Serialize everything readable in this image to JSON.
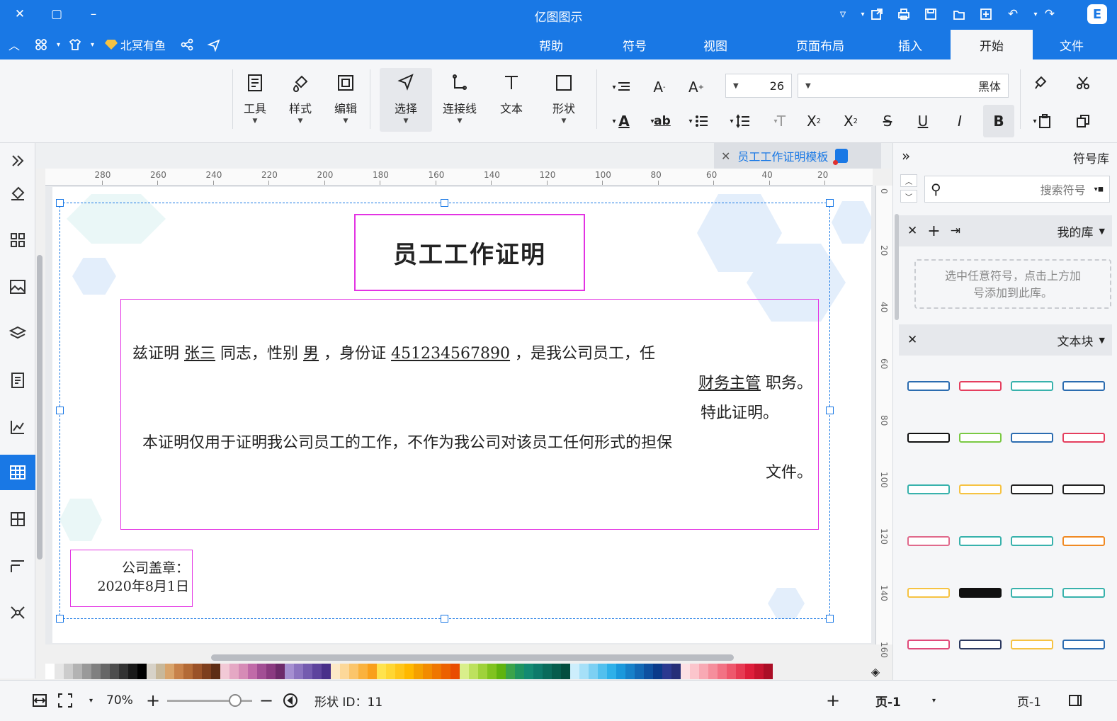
{
  "app": {
    "title": "亿图图示"
  },
  "tabs": [
    "文件",
    "开始",
    "插入",
    "页面布局",
    "视图",
    "符号",
    "帮助"
  ],
  "active_tab": "开始",
  "brand": {
    "label": "北冥有鱼"
  },
  "ribbon": {
    "tools": [
      {
        "icon": "tool-icon",
        "label": "工具"
      },
      {
        "icon": "style-icon",
        "label": "样式"
      },
      {
        "icon": "edit-icon",
        "label": "编辑"
      },
      {
        "icon": "select-icon",
        "label": "选择"
      },
      {
        "icon": "connector-icon",
        "label": "连接线"
      },
      {
        "icon": "text-icon",
        "label": "文本"
      },
      {
        "icon": "shape-icon",
        "label": "形状"
      }
    ],
    "font_size": "26",
    "font_name": "黑体",
    "font_color_glyph": "A",
    "highlight_glyph": "ab"
  },
  "document": {
    "tab_title": "员工工作证明模板"
  },
  "rulers": {
    "h": [
      "20",
      "40",
      "60",
      "80",
      "100",
      "120",
      "140",
      "160",
      "180",
      "200",
      "220",
      "240",
      "260",
      "280"
    ],
    "v": [
      "0",
      "20",
      "40",
      "60",
      "80",
      "100",
      "120",
      "140",
      "160"
    ]
  },
  "certificate": {
    "title": "员工工作证明",
    "line1": {
      "p1": "兹证明",
      "name": "张三",
      "p2": "同志，性别",
      "gender": "男",
      "p3": "，身份证",
      "id": "451234567890",
      "p4": "，是我公司员工，任"
    },
    "line2": {
      "position": "财务主管",
      "p5": "职务。"
    },
    "line3": "特此证明。",
    "line4": "本证明仅用于证明我公司员工的工作，不作为我公司对该员工任何形式的担保",
    "line5": "文件。",
    "stamp_line1": "公司盖章：",
    "stamp_line2": "2020年8月1日"
  },
  "statusbar": {
    "page_label": "页-1",
    "active_page": "页-1",
    "shape_id": "形状 ID：11",
    "zoom": "70%"
  },
  "symbol_panel": {
    "title": "符号库",
    "search_placeholder": "搜索符号",
    "my_library": "我的库",
    "drop_hint_1": "选中任意符号，点击上方加",
    "drop_hint_2": "号添加到此库。",
    "text_blocks": "文本块"
  },
  "colors": {
    "accent": "#1978e5",
    "selection": "#e333e3"
  }
}
